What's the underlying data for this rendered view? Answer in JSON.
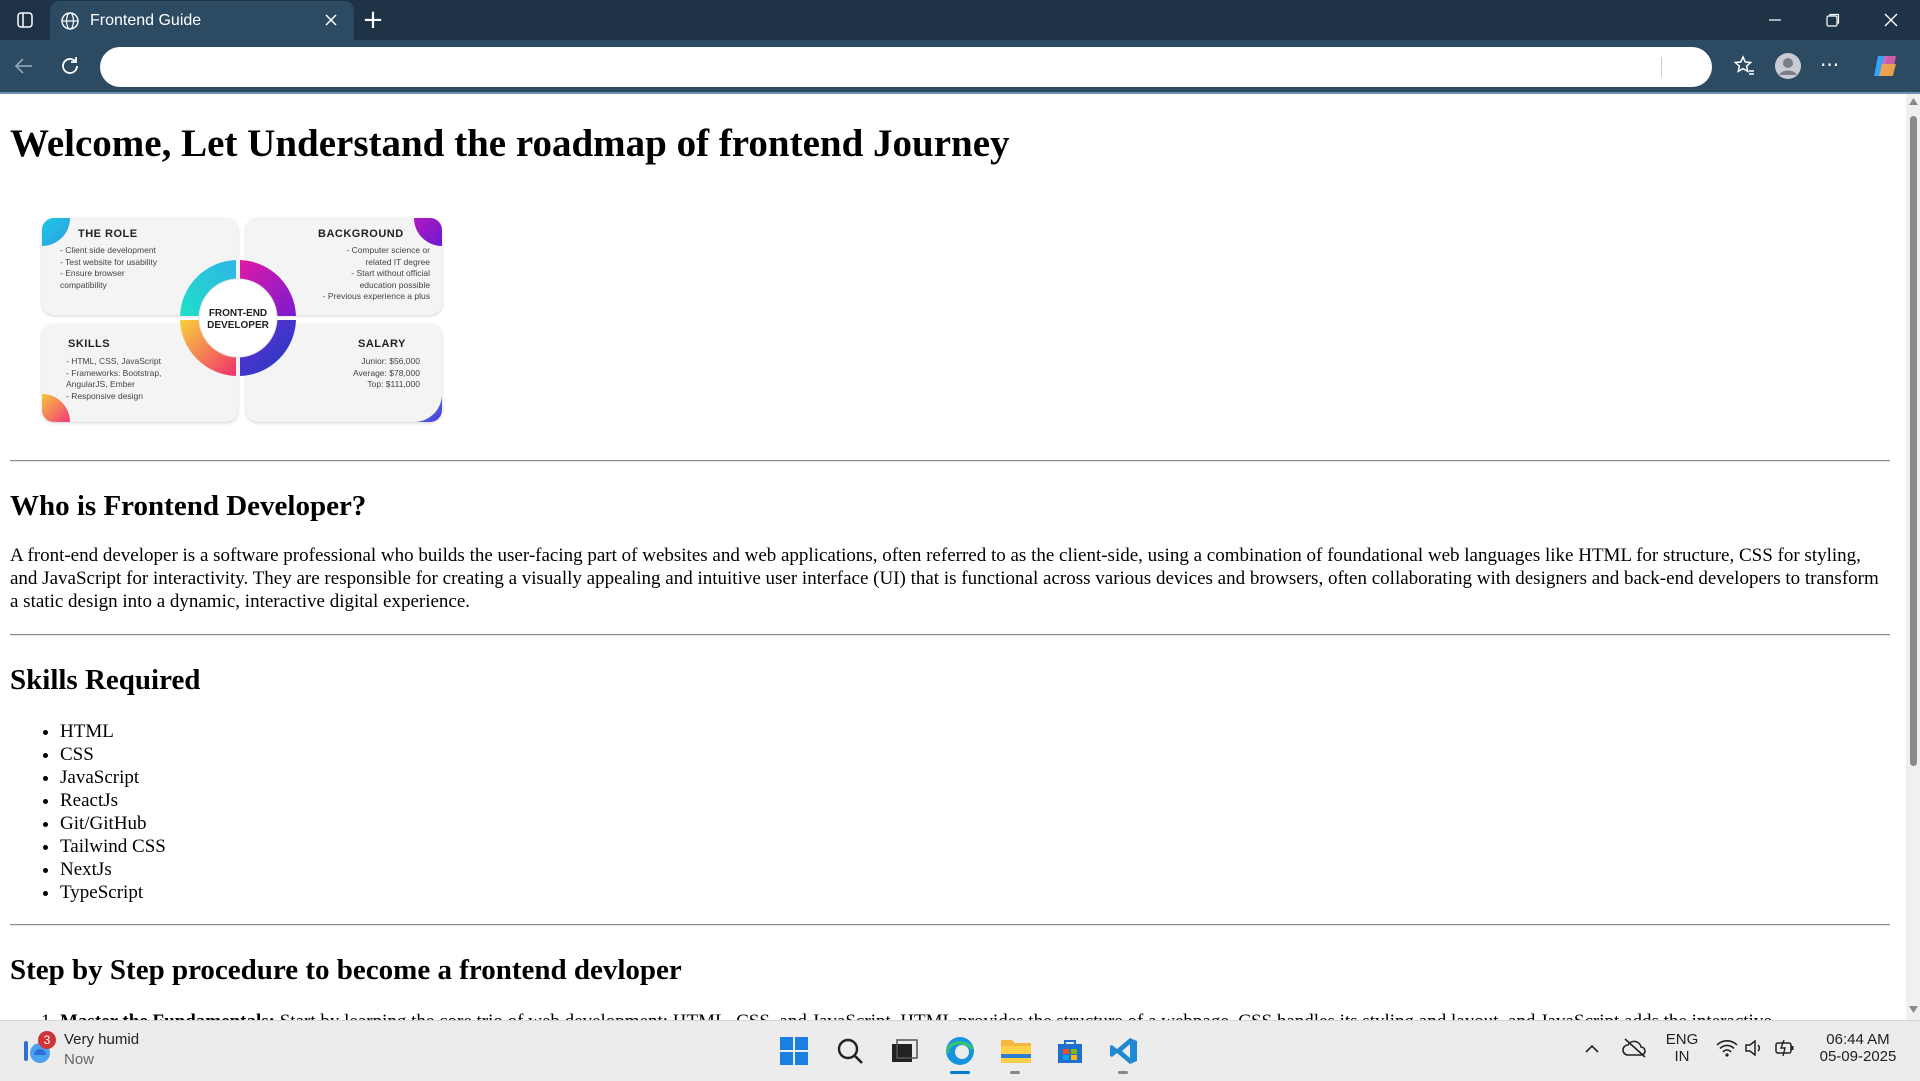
{
  "browser": {
    "tab_title": "Frontend Guide",
    "address_value": "",
    "new_tab_label": "+",
    "menu_label": "···"
  },
  "page": {
    "title": "Welcome, Let Understand the roadmap of frontend Journey",
    "infographic": {
      "center_line1": "FRONT-END",
      "center_line2": "DEVELOPER",
      "cards": [
        {
          "title": "THE ROLE",
          "lines": [
            "- Client side development",
            "- Test website for usability",
            "- Ensure browser",
            "  compatibility"
          ]
        },
        {
          "title": "BACKGROUND",
          "lines": [
            "- Computer science or",
            "related IT degree",
            "- Start without official",
            "education possible",
            "- Previous experience a plus"
          ]
        },
        {
          "title": "SKILLS",
          "lines": [
            "- HTML, CSS, JavaScript",
            "- Frameworks: Bootstrap,",
            "AngularJS, Ember",
            "- Responsive design"
          ]
        },
        {
          "title": "SALARY",
          "lines": [
            "Junior: $56,000",
            "Average: $78,000",
            "Top: $111,000"
          ]
        }
      ]
    },
    "who_heading": "Who is Frontend Developer?",
    "who_paragraph": "A front-end developer is a software professional who builds the user-facing part of websites and web applications, often referred to as the client-side, using a combination of foundational web languages like HTML for structure, CSS for styling, and JavaScript for interactivity. They are responsible for creating a visually appealing and intuitive user interface (UI) that is functional across various devices and browsers, often collaborating with designers and back-end developers to transform a static design into a dynamic, interactive digital experience.",
    "skills_heading": "Skills Required",
    "skills": [
      "HTML",
      "CSS",
      "JavaScript",
      "ReactJs",
      "Git/GitHub",
      "Tailwind CSS",
      "NextJs",
      "TypeScript"
    ],
    "steps_heading": "Step by Step procedure to become a frontend devloper",
    "steps": [
      {
        "title": "Master the Fundamentals:",
        "text": " Start by learning the core trio of web development: HTML, CSS, and JavaScript. HTML provides the structure of a webpage, CSS handles its styling and layout, and JavaScript adds the interactive"
      }
    ]
  },
  "taskbar": {
    "weather_badge": "3",
    "weather_text": "Very humid",
    "weather_sub": "Now",
    "lang_line1": "ENG",
    "lang_line2": "IN",
    "time": "06:44 AM",
    "date": "05-09-2025"
  },
  "colors": {
    "titlebar": "#1f3347",
    "toolbar": "#2d4a63",
    "accent_blue": "#0078d4"
  }
}
